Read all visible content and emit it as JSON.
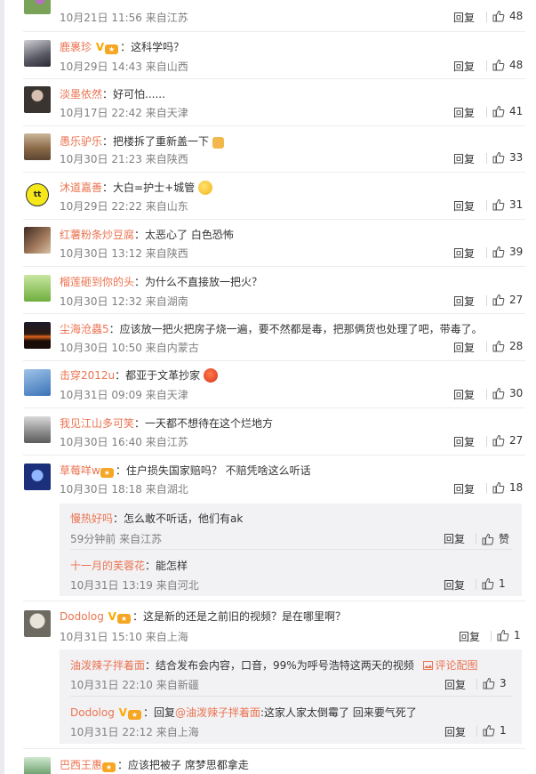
{
  "ui": {
    "reply_label": "回复"
  },
  "comments": [
    {
      "name": "",
      "text": "",
      "meta": "10月21日 11:56 来自江苏",
      "likes": "48"
    },
    {
      "name": "鹿裹珍",
      "text": "：这科学吗？",
      "meta": "10月29日 14:43 来自山西",
      "likes": "48"
    },
    {
      "name": "淡墨依然",
      "text": "：好可怕......",
      "meta": "10月17日 22:42 来自天津",
      "likes": "41"
    },
    {
      "name": "愚乐驴乐",
      "text": "：把楼拆了重新盖一下",
      "meta": "10月30日 21:23 来自陕西",
      "likes": "33"
    },
    {
      "name": "沐道嘉善",
      "text": "：大白=护士+城管",
      "meta": "10月29日 22:22 来自山东",
      "likes": "31"
    },
    {
      "name": "红薯粉条炒豆腐",
      "text": "：太恶心了 白色恐怖",
      "meta": "10月30日 13:12 来自陕西",
      "likes": "39"
    },
    {
      "name": "榴莲砸到你的头",
      "text": "：为什么不直接放一把火？",
      "meta": "10月30日 12:32 来自湖南",
      "likes": "27"
    },
    {
      "name": "尘海沧蟲5",
      "text": "：应该放一把火把房子烧一遍，要不然都是毒，把那俩货也处理了吧，带毒了。",
      "meta": "10月30日 10:50 来自内蒙古",
      "likes": "28"
    },
    {
      "name": "击穿2012u",
      "text": "：都亚于文革抄家",
      "meta": "10月31日 09:09 来自天津",
      "likes": "30"
    },
    {
      "name": "我见江山多可笑",
      "text": "：一天都不想待在这个烂地方",
      "meta": "10月30日 16:40 来自江苏",
      "likes": "27"
    },
    {
      "name": "草莓咩w",
      "text": "：住户损失国家赔吗？ 不赔凭啥这么听话",
      "meta": "10月30日 18:18 来自湖北",
      "likes": "18"
    },
    {
      "name": "Dodolog",
      "text": "：这是新的还是之前旧的视频？是在哪里啊？",
      "meta": "10月31日 15:10 来自上海",
      "likes": "1"
    },
    {
      "name": "巴西王惠",
      "text": "：应该把被子 席梦思都拿走",
      "meta": "",
      "likes": ""
    }
  ],
  "replies_a": [
    {
      "name": "慢热好吗",
      "text": "：怎么敢不听话，他们有ak",
      "meta": "59分钟前 来自江苏",
      "likes": "赞"
    },
    {
      "name": "十一月的芙蓉花",
      "text": "：能怎样",
      "meta": "10月31日 13:19 来自河北",
      "likes": "1"
    }
  ],
  "replies_b": [
    {
      "name": "油泼辣子拌着面",
      "text": "：结合发布会内容，口音，99%为呼号浩特这两天的视频",
      "extra": "评论配图",
      "meta": "10月31日 22:10 来自新疆",
      "likes": "3"
    },
    {
      "name": "Dodolog",
      "reply_prefix": "：回复",
      "mention": "@油泼辣子拌着面",
      "text": ":这家人家太倒霉了 回来要气死了",
      "meta": "10月31日 22:12 来自上海",
      "likes": "1"
    }
  ],
  "colors": {
    "username": "#eb7350",
    "meta": "#808080",
    "subbox": "#f2f2f5"
  }
}
